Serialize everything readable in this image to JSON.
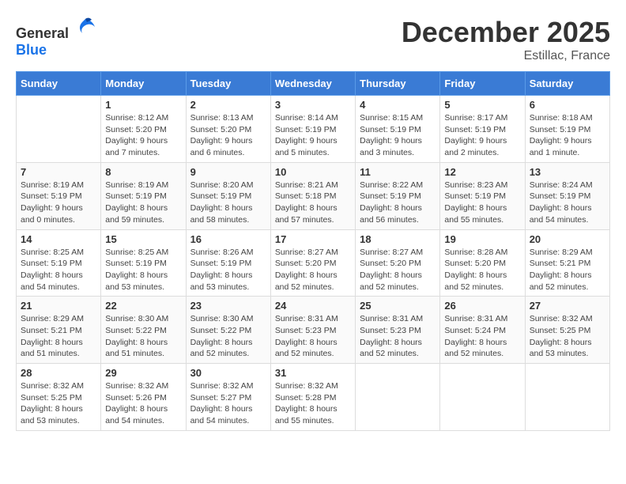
{
  "header": {
    "logo_general": "General",
    "logo_blue": "Blue",
    "title": "December 2025",
    "location": "Estillac, France"
  },
  "weekdays": [
    "Sunday",
    "Monday",
    "Tuesday",
    "Wednesday",
    "Thursday",
    "Friday",
    "Saturday"
  ],
  "weeks": [
    [
      {
        "day": "",
        "detail": ""
      },
      {
        "day": "1",
        "detail": "Sunrise: 8:12 AM\nSunset: 5:20 PM\nDaylight: 9 hours\nand 7 minutes."
      },
      {
        "day": "2",
        "detail": "Sunrise: 8:13 AM\nSunset: 5:20 PM\nDaylight: 9 hours\nand 6 minutes."
      },
      {
        "day": "3",
        "detail": "Sunrise: 8:14 AM\nSunset: 5:19 PM\nDaylight: 9 hours\nand 5 minutes."
      },
      {
        "day": "4",
        "detail": "Sunrise: 8:15 AM\nSunset: 5:19 PM\nDaylight: 9 hours\nand 3 minutes."
      },
      {
        "day": "5",
        "detail": "Sunrise: 8:17 AM\nSunset: 5:19 PM\nDaylight: 9 hours\nand 2 minutes."
      },
      {
        "day": "6",
        "detail": "Sunrise: 8:18 AM\nSunset: 5:19 PM\nDaylight: 9 hours\nand 1 minute."
      }
    ],
    [
      {
        "day": "7",
        "detail": "Sunrise: 8:19 AM\nSunset: 5:19 PM\nDaylight: 9 hours\nand 0 minutes."
      },
      {
        "day": "8",
        "detail": "Sunrise: 8:19 AM\nSunset: 5:19 PM\nDaylight: 8 hours\nand 59 minutes."
      },
      {
        "day": "9",
        "detail": "Sunrise: 8:20 AM\nSunset: 5:19 PM\nDaylight: 8 hours\nand 58 minutes."
      },
      {
        "day": "10",
        "detail": "Sunrise: 8:21 AM\nSunset: 5:18 PM\nDaylight: 8 hours\nand 57 minutes."
      },
      {
        "day": "11",
        "detail": "Sunrise: 8:22 AM\nSunset: 5:19 PM\nDaylight: 8 hours\nand 56 minutes."
      },
      {
        "day": "12",
        "detail": "Sunrise: 8:23 AM\nSunset: 5:19 PM\nDaylight: 8 hours\nand 55 minutes."
      },
      {
        "day": "13",
        "detail": "Sunrise: 8:24 AM\nSunset: 5:19 PM\nDaylight: 8 hours\nand 54 minutes."
      }
    ],
    [
      {
        "day": "14",
        "detail": "Sunrise: 8:25 AM\nSunset: 5:19 PM\nDaylight: 8 hours\nand 54 minutes."
      },
      {
        "day": "15",
        "detail": "Sunrise: 8:25 AM\nSunset: 5:19 PM\nDaylight: 8 hours\nand 53 minutes."
      },
      {
        "day": "16",
        "detail": "Sunrise: 8:26 AM\nSunset: 5:19 PM\nDaylight: 8 hours\nand 53 minutes."
      },
      {
        "day": "17",
        "detail": "Sunrise: 8:27 AM\nSunset: 5:20 PM\nDaylight: 8 hours\nand 52 minutes."
      },
      {
        "day": "18",
        "detail": "Sunrise: 8:27 AM\nSunset: 5:20 PM\nDaylight: 8 hours\nand 52 minutes."
      },
      {
        "day": "19",
        "detail": "Sunrise: 8:28 AM\nSunset: 5:20 PM\nDaylight: 8 hours\nand 52 minutes."
      },
      {
        "day": "20",
        "detail": "Sunrise: 8:29 AM\nSunset: 5:21 PM\nDaylight: 8 hours\nand 52 minutes."
      }
    ],
    [
      {
        "day": "21",
        "detail": "Sunrise: 8:29 AM\nSunset: 5:21 PM\nDaylight: 8 hours\nand 51 minutes."
      },
      {
        "day": "22",
        "detail": "Sunrise: 8:30 AM\nSunset: 5:22 PM\nDaylight: 8 hours\nand 51 minutes."
      },
      {
        "day": "23",
        "detail": "Sunrise: 8:30 AM\nSunset: 5:22 PM\nDaylight: 8 hours\nand 52 minutes."
      },
      {
        "day": "24",
        "detail": "Sunrise: 8:31 AM\nSunset: 5:23 PM\nDaylight: 8 hours\nand 52 minutes."
      },
      {
        "day": "25",
        "detail": "Sunrise: 8:31 AM\nSunset: 5:23 PM\nDaylight: 8 hours\nand 52 minutes."
      },
      {
        "day": "26",
        "detail": "Sunrise: 8:31 AM\nSunset: 5:24 PM\nDaylight: 8 hours\nand 52 minutes."
      },
      {
        "day": "27",
        "detail": "Sunrise: 8:32 AM\nSunset: 5:25 PM\nDaylight: 8 hours\nand 53 minutes."
      }
    ],
    [
      {
        "day": "28",
        "detail": "Sunrise: 8:32 AM\nSunset: 5:25 PM\nDaylight: 8 hours\nand 53 minutes."
      },
      {
        "day": "29",
        "detail": "Sunrise: 8:32 AM\nSunset: 5:26 PM\nDaylight: 8 hours\nand 54 minutes."
      },
      {
        "day": "30",
        "detail": "Sunrise: 8:32 AM\nSunset: 5:27 PM\nDaylight: 8 hours\nand 54 minutes."
      },
      {
        "day": "31",
        "detail": "Sunrise: 8:32 AM\nSunset: 5:28 PM\nDaylight: 8 hours\nand 55 minutes."
      },
      {
        "day": "",
        "detail": ""
      },
      {
        "day": "",
        "detail": ""
      },
      {
        "day": "",
        "detail": ""
      }
    ]
  ]
}
